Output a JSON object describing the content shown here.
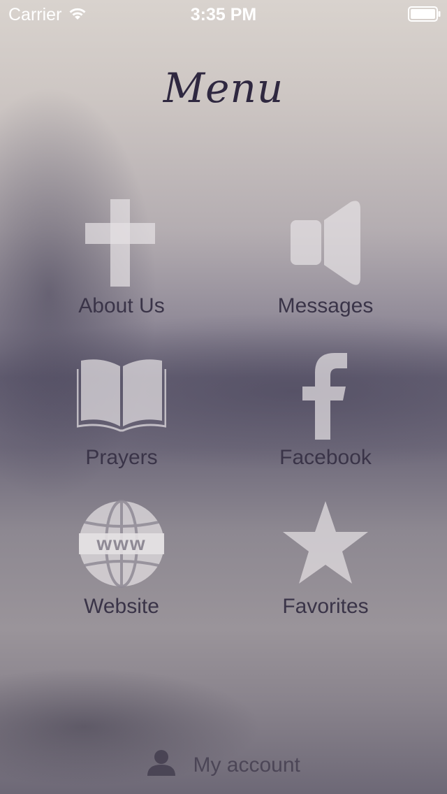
{
  "status_bar": {
    "carrier": "Carrier",
    "time": "3:35 PM",
    "wifi_icon": "wifi-icon",
    "battery_icon": "battery-icon"
  },
  "title": "Menu",
  "menu": [
    {
      "label": "About Us",
      "icon": "cross-icon"
    },
    {
      "label": "Messages",
      "icon": "speaker-icon"
    },
    {
      "label": "Prayers",
      "icon": "open-book-icon"
    },
    {
      "label": "Facebook",
      "icon": "facebook-icon"
    },
    {
      "label": "Website",
      "icon": "globe-www-icon"
    },
    {
      "label": "Favorites",
      "icon": "star-icon"
    }
  ],
  "account": {
    "label": "My account",
    "icon": "person-icon"
  },
  "colors": {
    "icon_fill": "#e4e1e3",
    "label_text": "#3a3448",
    "title_text": "#2f2840"
  }
}
